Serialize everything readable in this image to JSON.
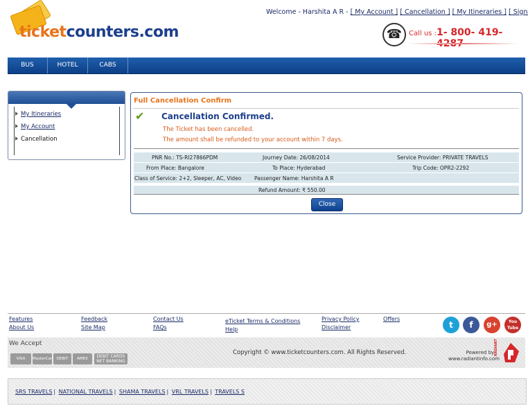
{
  "header": {
    "logo_text_part1": "ticket",
    "logo_text_part2": "counters.com",
    "welcome_text": "Welcome - Harshita A R -",
    "links": [
      "[ My Account ]",
      "[ Cancellation ]",
      "[ My Itineraries ]",
      "[ Sign Out ]"
    ],
    "call_label": "Call us :",
    "call_number": "1- 800- 419- 4287"
  },
  "nav": {
    "items": [
      "BUS",
      "HOTEL",
      "CABS"
    ]
  },
  "sidebar": {
    "items": [
      "My Itineraries",
      "My Account",
      "Cancellation"
    ]
  },
  "panel": {
    "title": "Full Cancellation Confirm",
    "heading": "Cancellation Confirmed.",
    "message1": "The Ticket has been cancelled.",
    "message2": "The amount shall be refunded to your account within 7 days.",
    "details": {
      "pnr": "PNR No.: TS-RI27866PDM",
      "journey_date": "Journey Date: 26/08/2014",
      "service_provider": "Service Provider: PRIVATE TRAVELS",
      "from_place": "From Place: Bangalore",
      "to_place": "To Place: Hyderabad",
      "trip_code": "Trip Code: OPR2-2292",
      "class_of_service": "Class of Service: 2+2, Sleeper, AC, Video",
      "passenger_name": "Passenger Name: Harshita A R",
      "refund_amount": "Refund Amount: ₹ 550.00"
    },
    "close_label": "Close"
  },
  "footer": {
    "col1": [
      "Features",
      "About Us"
    ],
    "col2": [
      "Feedback",
      "Site Map"
    ],
    "col3": [
      "Contact Us",
      "FAQs"
    ],
    "col4": [
      "eTicket Terms & Conditions",
      "Help"
    ],
    "col5": [
      "Privacy Policy",
      "Disclaimer"
    ],
    "col6": [
      "Offers"
    ],
    "social": [
      "t",
      "f",
      "g+",
      "You Tube"
    ],
    "accept_label": "We Accept",
    "cards": [
      "VISA",
      "MasterCard",
      "DEBIT",
      "AMEX",
      "DEBIT CARDS NET BANKING"
    ],
    "copyright": "Copyright © www.ticketcounters.com. All Rights Reserved.",
    "powered_by": "Powered by:",
    "powered_url": "www.radiantinfo.com",
    "radiant_text": "RADIANT",
    "partners": [
      "SRS TRAVELS",
      "NATIONAL TRAVELS",
      "SHAMA TRAVELS",
      "VRL TRAVELS",
      "TRAVELS S"
    ]
  },
  "colors": {
    "brand_blue": "#1d3f8c",
    "brand_orange": "#e8731a",
    "call_red": "#d6262a",
    "nav_blue": "#0d3f86"
  }
}
